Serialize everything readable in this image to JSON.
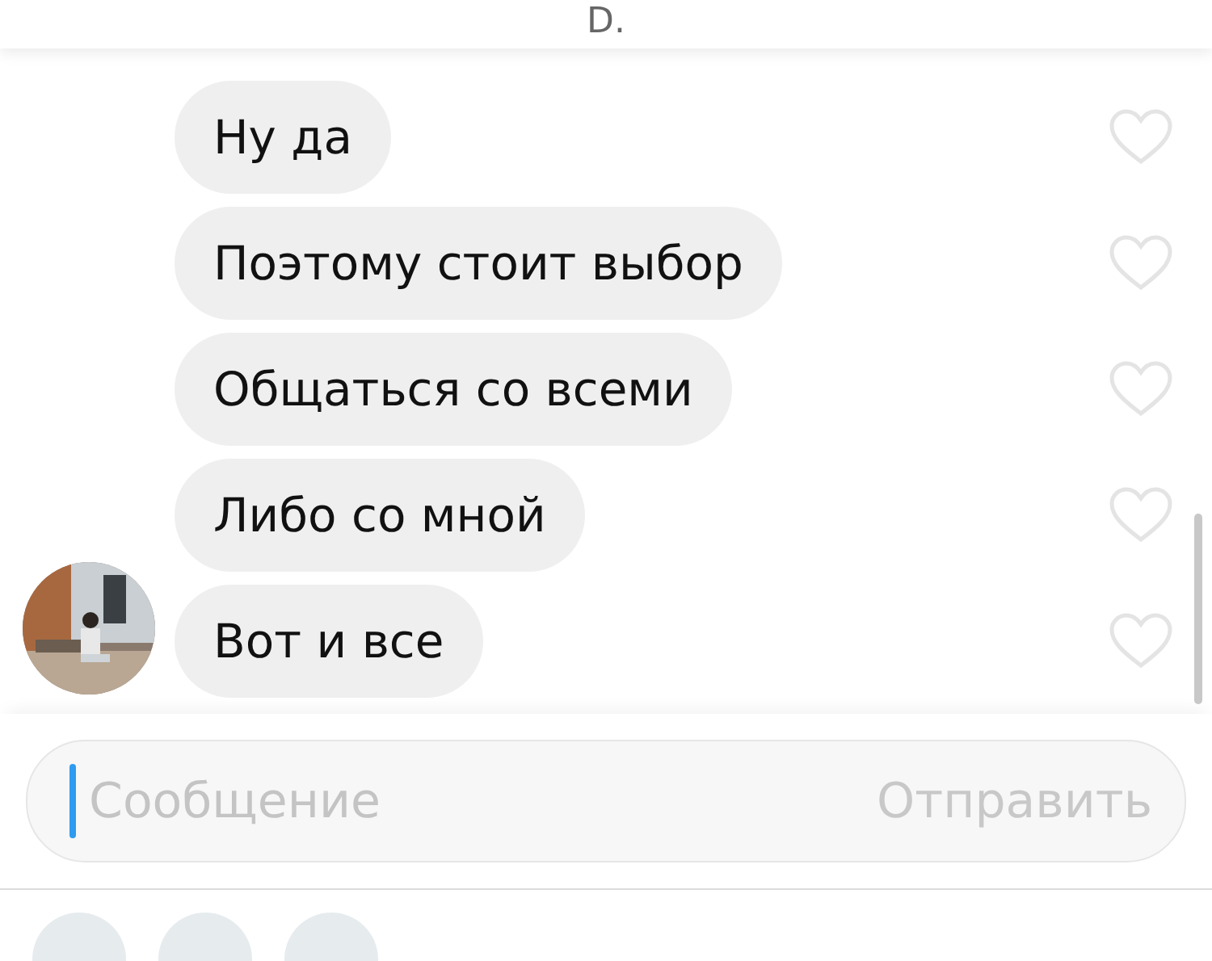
{
  "header": {
    "title": "D."
  },
  "messages": [
    {
      "text": "Ну да",
      "liked": false,
      "avatar": false
    },
    {
      "text": "Поэтому стоит выбор",
      "liked": false,
      "avatar": false
    },
    {
      "text": "Общаться со всеми",
      "liked": false,
      "avatar": false
    },
    {
      "text": "Либо со мной",
      "liked": false,
      "avatar": false
    },
    {
      "text": "Вот и все",
      "liked": false,
      "avatar": true
    }
  ],
  "composer": {
    "placeholder": "Сообщение",
    "send": {
      "label": "Отправить",
      "disabled": true
    }
  },
  "quick_actions": [
    {
      "kind": "circle"
    },
    {
      "kind": "circle"
    },
    {
      "kind": "circle"
    }
  ]
}
